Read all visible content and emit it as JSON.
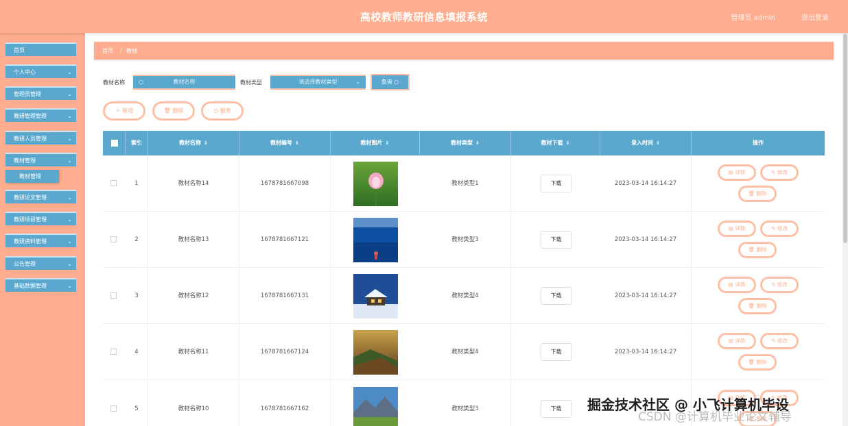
{
  "app": {
    "title": "高校教师教研信息填报系统",
    "user": "管理员 admin",
    "logout": "退出登录"
  },
  "sidebar": {
    "items": [
      {
        "label": "首页"
      },
      {
        "label": "个人中心"
      },
      {
        "label": "管理员管理"
      },
      {
        "label": "教研管理管理"
      },
      {
        "label": "教研人员管理"
      },
      {
        "label": "教材管理"
      },
      {
        "label": "教研论文管理"
      },
      {
        "label": "教研项目管理"
      },
      {
        "label": "教研资料管理"
      },
      {
        "label": "公告管理"
      },
      {
        "label": "基础数据管理"
      }
    ],
    "sub_item": "教材管理"
  },
  "breadcrumb": {
    "home": "首页",
    "current": "教材"
  },
  "search": {
    "name_label": "教材名称",
    "name_placeholder": "教材名称",
    "type_label": "教材类型",
    "type_placeholder": "请选择教材类型",
    "query_button": "查询"
  },
  "toolbar": {
    "add": "新增",
    "delete": "删除",
    "report": "报表"
  },
  "table": {
    "headers": [
      "索引",
      "教材名称",
      "教材编号",
      "教材图片",
      "教材类型",
      "教材下载",
      "录入时间",
      "操作"
    ],
    "rows": [
      {
        "index": "1",
        "name": "教材名称14",
        "code": "1678781667098",
        "type": "教材类型1",
        "time": "2023-03-14 16:14:27"
      },
      {
        "index": "2",
        "name": "教材名称13",
        "code": "1678781667121",
        "type": "教材类型3",
        "time": "2023-03-14 16:14:27"
      },
      {
        "index": "3",
        "name": "教材名称12",
        "code": "1678781667131",
        "type": "教材类型4",
        "time": "2023-03-14 16:14:27"
      },
      {
        "index": "4",
        "name": "教材名称11",
        "code": "1678781667124",
        "type": "教材类型4",
        "time": "2023-03-14 16:14:27"
      },
      {
        "index": "5",
        "name": "教材名称10",
        "code": "1678781667162",
        "type": "教材类型3",
        "time": ""
      }
    ],
    "download_label": "下载",
    "detail_label": "详情",
    "edit_label": "修改",
    "delete_label": "删除"
  },
  "watermark": {
    "line1": "掘金技术社区 @ 小飞计算机毕设",
    "line2": "CSDN @计算机毕业论文辅导"
  },
  "colors": {
    "primary": "#5ba8cf",
    "accent": "#ffad8e",
    "accent_light": "#ffbfa5"
  }
}
